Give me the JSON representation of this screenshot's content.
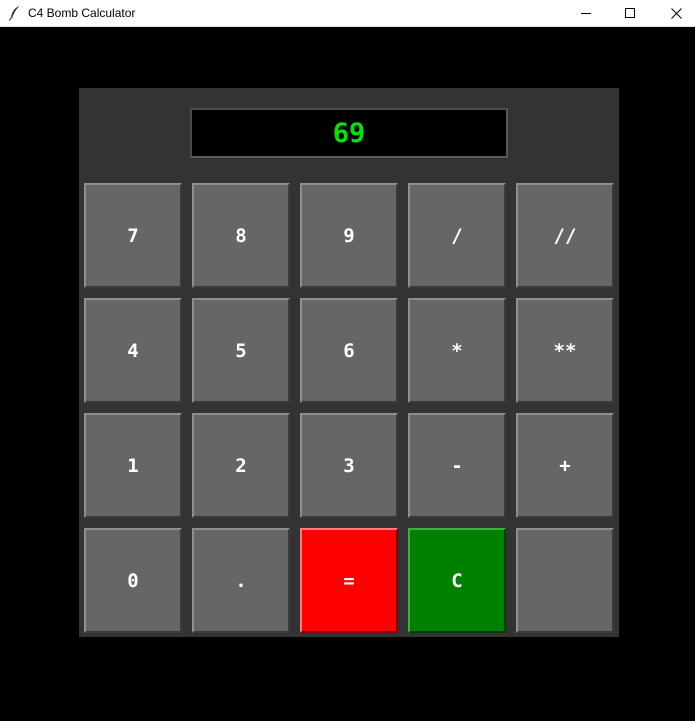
{
  "window": {
    "title": "C4 Bomb Calculator",
    "icon": "feather-icon",
    "controls": [
      "minimize-icon",
      "maximize-icon",
      "close-icon"
    ]
  },
  "display": {
    "value": "69",
    "color": "#00e600"
  },
  "keys": {
    "row1": [
      "7",
      "8",
      "9",
      "/",
      "//"
    ],
    "row2": [
      "4",
      "5",
      "6",
      "*",
      "**"
    ],
    "row3": [
      "1",
      "2",
      "3",
      "-",
      "+"
    ],
    "row4": [
      "0",
      ".",
      "=",
      "C",
      ""
    ]
  },
  "colors": {
    "panel": "#333333",
    "key": "#666666",
    "equals_key": "#ff0000",
    "clear_key": "#008000"
  }
}
